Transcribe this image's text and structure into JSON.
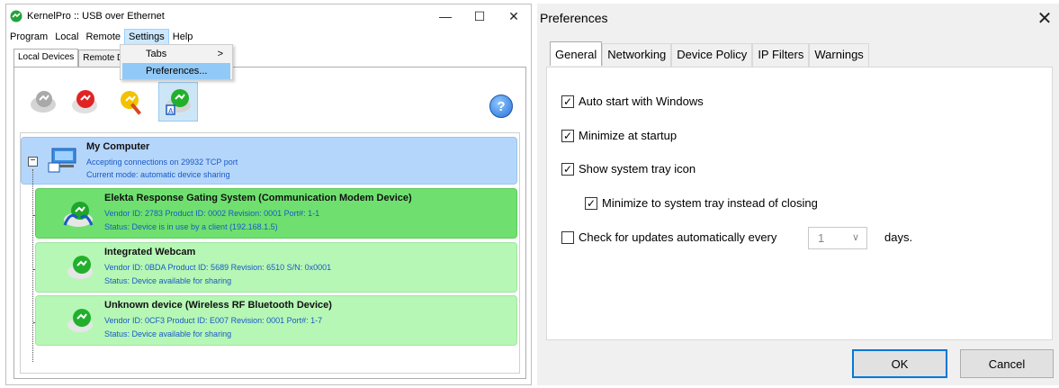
{
  "left_window": {
    "title": "KernelPro :: USB over Ethernet",
    "controls": {
      "minimize": "—",
      "maximize": "☐",
      "close": "✕"
    },
    "menu": [
      "Program",
      "Local",
      "Remote",
      "Settings",
      "Help"
    ],
    "settings_menu": {
      "tabs": "Tabs",
      "tabs_arrow": ">",
      "preferences": "Preferences..."
    },
    "tabs": {
      "local": "Local Devices",
      "remote": "Remote De"
    },
    "help_icon": "?",
    "tree": {
      "expander": "−",
      "computer": {
        "title": "My Computer",
        "line1": "Accepting connections on 29932 TCP port",
        "line2": "Current mode: automatic device sharing"
      },
      "devices": [
        {
          "title": "Elekta Response Gating System (Communication Modem Device)",
          "line1": "Vendor ID: 2783   Product ID: 0002   Revision: 0001   Port#: 1-1",
          "line2": "Status: Device is in use by a client (192.168.1.5)",
          "status": "in-use"
        },
        {
          "title": "Integrated Webcam",
          "line1": "Vendor ID: 0BDA   Product ID: 5689   Revision: 6510   S/N: 0x0001",
          "line2": "Status: Device available for sharing",
          "status": "available"
        },
        {
          "title": "Unknown device (Wireless RF Bluetooth Device)",
          "line1": "Vendor ID: 0CF3   Product ID: E007   Revision: 0001   Port#: 1-7",
          "line2": "Status: Device available for sharing",
          "status": "available"
        }
      ]
    }
  },
  "dialog": {
    "title": "Preferences",
    "close": "✕",
    "tabs": [
      "General",
      "Networking",
      "Device Policy",
      "IP Filters",
      "Warnings"
    ],
    "options": {
      "autostart": {
        "label": "Auto start with Windows",
        "checked": true
      },
      "minimize_startup": {
        "label": "Minimize at startup",
        "checked": true
      },
      "tray_icon": {
        "label": "Show system tray icon",
        "checked": true
      },
      "minimize_tray": {
        "label": "Minimize to system tray instead of closing",
        "checked": true
      },
      "updates": {
        "label": "Check for updates automatically every",
        "checked": false
      }
    },
    "check_mark": "✓",
    "update_days": "1",
    "select_arrow": "∨",
    "days_label": "days.",
    "ok": "OK",
    "cancel": "Cancel"
  },
  "colors": {
    "computer_node": "#b5d6fb",
    "in_use_node": "#6fe06f",
    "available_node": "#b6f7b6",
    "link_text": "#1a59c4",
    "ok_border": "#0078d7"
  }
}
